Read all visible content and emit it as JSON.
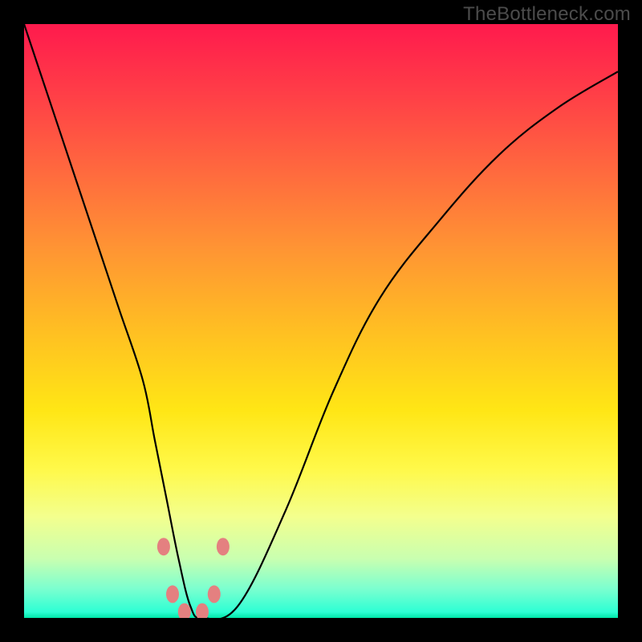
{
  "watermark": "TheBottleneck.com",
  "colors": {
    "frame_bg_top": "#ff1a4d",
    "frame_bg_bottom": "#00e6a8",
    "curve_stroke": "#000000",
    "dot_fill": "#e48080",
    "page_bg": "#000000",
    "watermark_color": "#4c4c4c"
  },
  "chart_data": {
    "type": "line",
    "title": "",
    "xlabel": "",
    "ylabel": "",
    "xlim": [
      0,
      100
    ],
    "ylim": [
      0,
      100
    ],
    "grid": false,
    "legend": false,
    "series": [
      {
        "name": "bottleneck-curve",
        "x": [
          0,
          4,
          8,
          12,
          16,
          20,
          22,
          24,
          26,
          28,
          30,
          36,
          44,
          52,
          60,
          70,
          80,
          90,
          100
        ],
        "values": [
          100,
          88,
          76,
          64,
          52,
          40,
          30,
          20,
          10,
          2,
          0,
          2,
          18,
          38,
          54,
          67,
          78,
          86,
          92
        ]
      }
    ],
    "vertex_x": 28,
    "markers": [
      {
        "x": 23.5,
        "y": 12
      },
      {
        "x": 25.0,
        "y": 4
      },
      {
        "x": 27.0,
        "y": 1
      },
      {
        "x": 30.0,
        "y": 1
      },
      {
        "x": 32.0,
        "y": 4
      },
      {
        "x": 33.5,
        "y": 12
      }
    ]
  }
}
